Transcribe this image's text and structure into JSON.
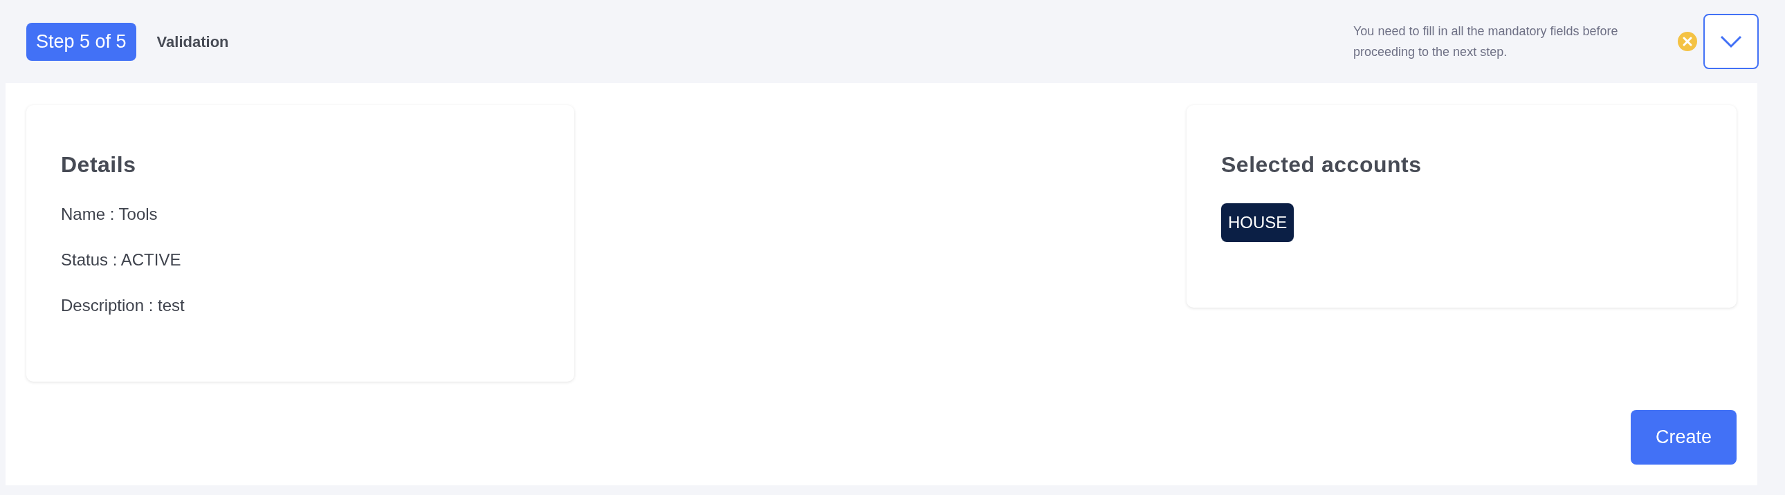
{
  "header": {
    "step_badge": "Step 5 of 5",
    "step_title": "Validation",
    "warning": "You need to fill in all the mandatory fields before proceeding to the next step.",
    "expanded": false
  },
  "details": {
    "title": "Details",
    "lines": [
      "Name : Tools",
      "Status : ACTIVE",
      "Description : test"
    ]
  },
  "accounts": {
    "title": "Selected accounts",
    "tags": [
      "HOUSE"
    ]
  },
  "actions": {
    "create": "Create"
  }
}
